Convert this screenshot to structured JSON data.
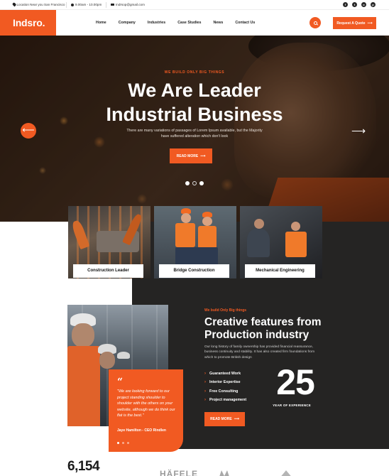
{
  "topbar": {
    "location": "Location Near you San Francisco",
    "hours": "9.00am - 10.00pm",
    "email": "Indrsop@gmail.com",
    "social_icons": [
      "facebook-icon",
      "twitter-icon",
      "instagram-icon",
      "pinterest-icon"
    ]
  },
  "header": {
    "logo": "Indsro.",
    "nav": [
      "Home",
      "Company",
      "Industries",
      "Case Studies",
      "News",
      "Contact Us"
    ],
    "quote_button": "Request A Quote"
  },
  "hero": {
    "eyebrow": "WE BUILD ONLY BIG THINGS",
    "title_line1": "We Are Leader",
    "title_line2": "Industrial Business",
    "description": "There are many variations of passages of Lorem Ipsum available, but the Majority have suffered alteration which don't look",
    "button": "READ MORE",
    "slide_active": 1,
    "slide_count": 3
  },
  "services": [
    {
      "label": "Construction Leader"
    },
    {
      "label": "Bridge Construction"
    },
    {
      "label": "Mechanical Engineering"
    }
  ],
  "about": {
    "eyebrow": "We build Only Big things",
    "title": "Creative features from Production industry",
    "description": "Our long history of family ownership has provided financial reassurance, business continuity and stability. It has also created firm foundations from which to promote British design",
    "features": [
      "Guaranteed Work",
      "Interior Expertise",
      "Free Consulting",
      "Project management"
    ],
    "years": "25",
    "years_label": "YEAR OF EXPERIENCE",
    "button": "READ MORE",
    "quote": {
      "text": "\"We are looking forward to our project standing shoulder to shoulder with the others on your website, although we do think our flat is the best.\"",
      "author": "Jaye Hamilton - CEO Rindlen"
    }
  },
  "stats": {
    "counter": "6,154",
    "brand_logo": "HÄFELE"
  },
  "colors": {
    "accent": "#f15a22",
    "dark": "#252423"
  }
}
